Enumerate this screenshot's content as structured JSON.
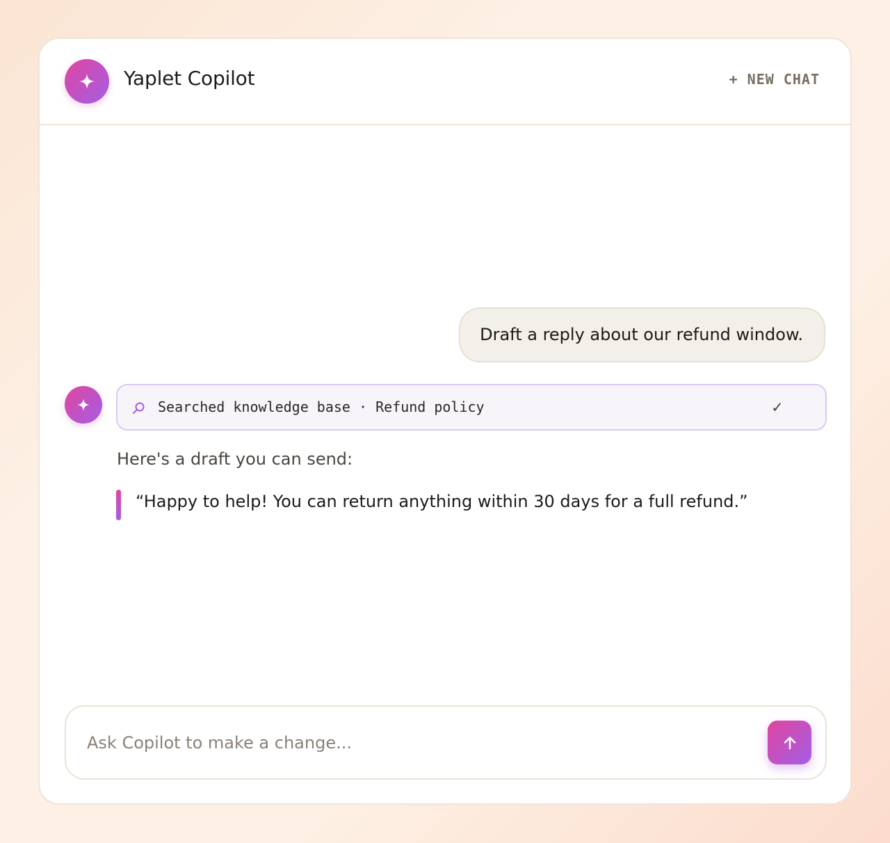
{
  "header": {
    "title": "Yaplet Copilot",
    "new_chat_label": "+ NEW CHAT",
    "avatar_icon": "sparkle-icon"
  },
  "conversation": {
    "user_message": "Draft a reply about our refund window.",
    "tool_call": {
      "icon": "search-icon",
      "text": "Searched knowledge base · Refund policy",
      "status_icon": "checkmark-icon",
      "status_glyph": "✓"
    },
    "assistant_intro": "Here's a draft you can send:",
    "assistant_quote": "“Happy to help! You can return anything within 30 days for a full refund.”"
  },
  "composer": {
    "placeholder": "Ask Copilot to make a change...",
    "value": "",
    "send_icon": "arrow-up-icon"
  },
  "colors": {
    "accent_start": "#e0459f",
    "accent_end": "#a35ee6",
    "user_bubble": "#f3efe9",
    "tool_card_border": "#dcc9f0"
  }
}
